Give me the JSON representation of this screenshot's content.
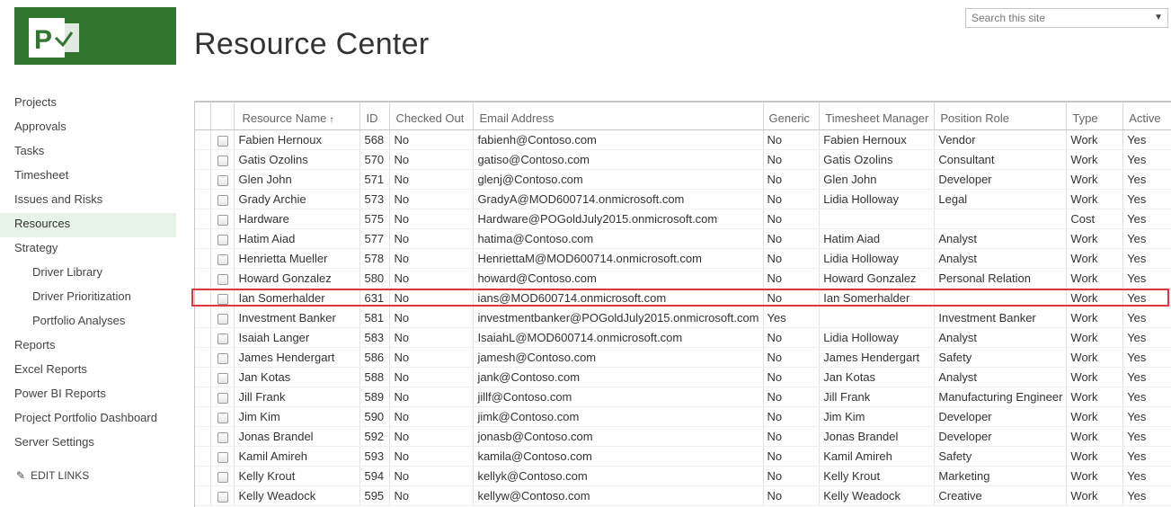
{
  "header": {
    "title": "Resource Center",
    "search_placeholder": "Search this site",
    "logo_icon": "project-logo-icon"
  },
  "nav": {
    "items": [
      {
        "label": "Projects"
      },
      {
        "label": "Approvals"
      },
      {
        "label": "Tasks"
      },
      {
        "label": "Timesheet"
      },
      {
        "label": "Issues and Risks"
      },
      {
        "label": "Resources",
        "active": true
      },
      {
        "label": "Strategy"
      },
      {
        "label": "Driver Library",
        "sub": true
      },
      {
        "label": "Driver Prioritization",
        "sub": true
      },
      {
        "label": "Portfolio Analyses",
        "sub": true
      },
      {
        "label": "Reports"
      },
      {
        "label": "Excel Reports"
      },
      {
        "label": "Power BI Reports"
      },
      {
        "label": "Project Portfolio Dashboard"
      },
      {
        "label": "Server Settings"
      }
    ],
    "edit_links": "EDIT LINKS"
  },
  "grid": {
    "columns": [
      "Resource Name",
      "ID",
      "Checked Out",
      "Email Address",
      "Generic",
      "Timesheet Manager",
      "Position Role",
      "Type",
      "Active"
    ],
    "sort_indicator": "↑",
    "highlighted_row": 8,
    "rows": [
      [
        "Fabien Hernoux",
        "568",
        "No",
        "fabienh@Contoso.com",
        "No",
        "Fabien Hernoux",
        "Vendor",
        "Work",
        "Yes"
      ],
      [
        "Gatis Ozolins",
        "570",
        "No",
        "gatiso@Contoso.com",
        "No",
        "Gatis Ozolins",
        "Consultant",
        "Work",
        "Yes"
      ],
      [
        "Glen John",
        "571",
        "No",
        "glenj@Contoso.com",
        "No",
        "Glen John",
        "Developer",
        "Work",
        "Yes"
      ],
      [
        "Grady Archie",
        "573",
        "No",
        "GradyA@MOD600714.onmicrosoft.com",
        "No",
        "Lidia Holloway",
        "Legal",
        "Work",
        "Yes"
      ],
      [
        "Hardware",
        "575",
        "No",
        "Hardware@POGoldJuly2015.onmicrosoft.com",
        "No",
        "",
        "",
        "Cost",
        "Yes"
      ],
      [
        "Hatim Aiad",
        "577",
        "No",
        "hatima@Contoso.com",
        "No",
        "Hatim Aiad",
        "Analyst",
        "Work",
        "Yes"
      ],
      [
        "Henrietta Mueller",
        "578",
        "No",
        "HenriettaM@MOD600714.onmicrosoft.com",
        "No",
        "Lidia Holloway",
        "Analyst",
        "Work",
        "Yes"
      ],
      [
        "Howard Gonzalez",
        "580",
        "No",
        "howard@Contoso.com",
        "No",
        "Howard Gonzalez",
        "Personal Relation",
        "Work",
        "Yes"
      ],
      [
        "Ian Somerhalder",
        "631",
        "No",
        "ians@MOD600714.onmicrosoft.com",
        "No",
        "Ian Somerhalder",
        "",
        "Work",
        "Yes"
      ],
      [
        "Investment Banker",
        "581",
        "No",
        "investmentbanker@POGoldJuly2015.onmicrosoft.com",
        "Yes",
        "",
        "Investment Banker",
        "Work",
        "Yes"
      ],
      [
        "Isaiah Langer",
        "583",
        "No",
        "IsaiahL@MOD600714.onmicrosoft.com",
        "No",
        "Lidia Holloway",
        "Analyst",
        "Work",
        "Yes"
      ],
      [
        "James Hendergart",
        "586",
        "No",
        "jamesh@Contoso.com",
        "No",
        "James Hendergart",
        "Safety",
        "Work",
        "Yes"
      ],
      [
        "Jan Kotas",
        "588",
        "No",
        "jank@Contoso.com",
        "No",
        "Jan Kotas",
        "Analyst",
        "Work",
        "Yes"
      ],
      [
        "Jill Frank",
        "589",
        "No",
        "jillf@Contoso.com",
        "No",
        "Jill Frank",
        "Manufacturing Engineer",
        "Work",
        "Yes"
      ],
      [
        "Jim Kim",
        "590",
        "No",
        "jimk@Contoso.com",
        "No",
        "Jim Kim",
        "Developer",
        "Work",
        "Yes"
      ],
      [
        "Jonas Brandel",
        "592",
        "No",
        "jonasb@Contoso.com",
        "No",
        "Jonas Brandel",
        "Developer",
        "Work",
        "Yes"
      ],
      [
        "Kamil Amireh",
        "593",
        "No",
        "kamila@Contoso.com",
        "No",
        "Kamil Amireh",
        "Safety",
        "Work",
        "Yes"
      ],
      [
        "Kelly Krout",
        "594",
        "No",
        "kellyk@Contoso.com",
        "No",
        "Kelly Krout",
        "Marketing",
        "Work",
        "Yes"
      ],
      [
        "Kelly Weadock",
        "595",
        "No",
        "kellyw@Contoso.com",
        "No",
        "Kelly Weadock",
        "Creative",
        "Work",
        "Yes"
      ]
    ]
  }
}
